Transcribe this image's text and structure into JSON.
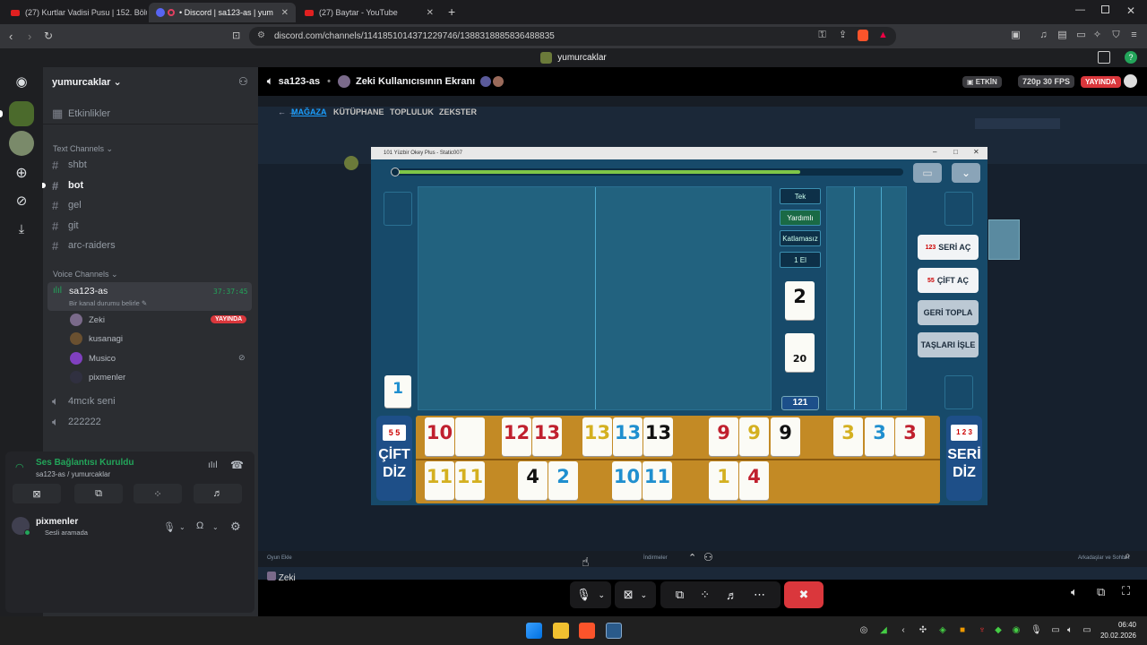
{
  "browser": {
    "tabs": [
      {
        "label": "(27) Kurtlar Vadisi Pusu | 152. Bölüm"
      },
      {
        "label": "• Discord | sa123-as | yumurcaklar"
      },
      {
        "label": "(27) Baytar - YouTube"
      }
    ],
    "url": "discord.com/channels/1141851014371229746/1388318885836488835"
  },
  "discord": {
    "window_title": "yumurcaklar",
    "server_name": "yumurcaklar",
    "events_label": "Etkinlikler",
    "text_category": "Text Channels",
    "text_channels": [
      "shbt",
      "bot",
      "gel",
      "git",
      "arc-raiders"
    ],
    "voice_category": "Voice Channels",
    "active_voice": {
      "name": "sa123-as",
      "time": "37:37:45",
      "status": "Bir kanal durumu belirle"
    },
    "voice_users": [
      {
        "name": "Zeki",
        "badge": "YAYINDA"
      },
      {
        "name": "kusanagi"
      },
      {
        "name": "Musico"
      },
      {
        "name": "pixmenler"
      }
    ],
    "other_voice": [
      "4mcık seni",
      "222222"
    ],
    "connection": {
      "title": "Ses Bağlantısı Kuruldu",
      "subtitle": "sa123-as / yumurcaklar"
    },
    "user": {
      "name": "pixmenler",
      "status": "Sesli aramada"
    }
  },
  "stream": {
    "channel": "sa123-as",
    "title": "Zeki Kullanıcısının Ekranı",
    "badge_active": "ETKİN",
    "quality": "720p 30 FPS",
    "live": "YAYINDA",
    "streamer_label": "Zeki"
  },
  "steam": {
    "tabs": [
      "MAĞAZA",
      "KÜTÜPHANE",
      "TOPLULUK",
      "ZEKSTER"
    ],
    "bottom_left": "Oyun Ekle",
    "bottom_mid": "İndirmeler",
    "bottom_right": "Arkadaşlar ve Sohbet"
  },
  "game": {
    "window_title": "101 Yüzbir Okey Plus - Static007",
    "modes": [
      "Tek",
      "Yardımlı",
      "Katlamasız",
      "1 El"
    ],
    "counter_top": "2",
    "counter_bottom": "20",
    "score": "121",
    "side_tile": "1",
    "progress": 0.8,
    "buttons": [
      "SERİ AÇ",
      "ÇİFT AÇ",
      "GERİ TOPLA",
      "TAŞLARI İŞLE"
    ],
    "left_button": "ÇİFT DİZ",
    "right_button": "SERİ DİZ",
    "left_button_icon": "5 5",
    "right_button_icon": "1 2 3",
    "rack_top": [
      {
        "v": "10",
        "c": "#c0202e"
      },
      {
        "v": "",
        "c": "#c0202e"
      },
      {
        "v": "12",
        "c": "#c0202e"
      },
      {
        "v": "13",
        "c": "#c0202e"
      },
      {
        "v": "13",
        "c": "#d4b020"
      },
      {
        "v": "13",
        "c": "#1f8fcf"
      },
      {
        "v": "13",
        "c": "#111111"
      },
      {
        "v": "9",
        "c": "#c0202e"
      },
      {
        "v": "9",
        "c": "#d4b020"
      },
      {
        "v": "9",
        "c": "#111111"
      },
      {
        "v": "3",
        "c": "#d4b020"
      },
      {
        "v": "3",
        "c": "#1f8fcf"
      },
      {
        "v": "3",
        "c": "#c0202e"
      }
    ],
    "rack_bottom": [
      {
        "v": "11",
        "c": "#d4b020"
      },
      {
        "v": "11",
        "c": "#d4b020"
      },
      {
        "v": "4",
        "c": "#111111"
      },
      {
        "v": "2",
        "c": "#1f8fcf"
      },
      {
        "v": "10",
        "c": "#1f8fcf"
      },
      {
        "v": "11",
        "c": "#1f8fcf"
      },
      {
        "v": "1",
        "c": "#d4b020"
      },
      {
        "v": "4",
        "c": "#c0202e"
      }
    ]
  },
  "taskbar": {
    "time": "06:40",
    "date": "20.02.2026"
  },
  "colors": {
    "accent": "#5865f2",
    "live": "#da373c",
    "connected": "#23a55a",
    "hangup": "#da373c"
  }
}
